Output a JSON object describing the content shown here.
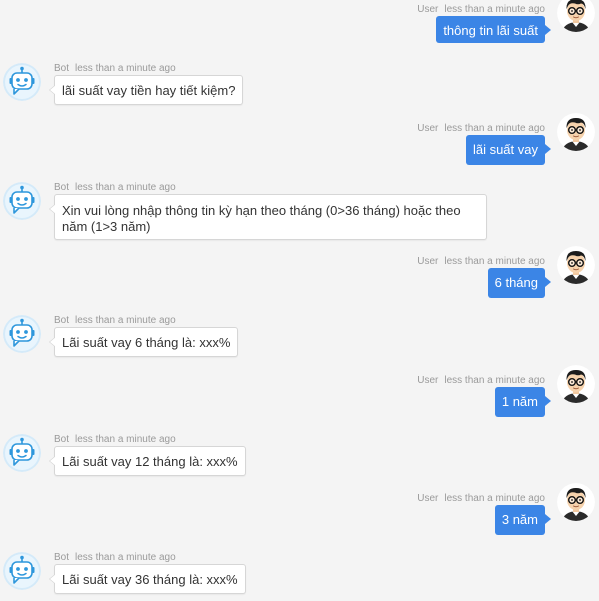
{
  "messages": [
    {
      "sender": "User",
      "time": "less than a minute ago",
      "text": "thông tin lãi suất"
    },
    {
      "sender": "Bot",
      "time": "less than a minute ago",
      "text": "lãi suất vay tiền hay tiết kiệm?"
    },
    {
      "sender": "User",
      "time": "less than a minute ago",
      "text": "lãi suất vay"
    },
    {
      "sender": "Bot",
      "time": "less than a minute ago",
      "text": "Xin vui lòng nhập thông tin kỳ hạn theo tháng (0>36 tháng) hoặc theo năm (1>3 năm)"
    },
    {
      "sender": "User",
      "time": "less than a minute ago",
      "text": "6 tháng"
    },
    {
      "sender": "Bot",
      "time": "less than a minute ago",
      "text": "Lãi suất vay 6 tháng là: xxx%"
    },
    {
      "sender": "User",
      "time": "less than a minute ago",
      "text": "1 năm"
    },
    {
      "sender": "Bot",
      "time": "less than a minute ago",
      "text": "Lãi suất vay 12 tháng là: xxx%"
    },
    {
      "sender": "User",
      "time": "less than a minute ago",
      "text": "3 năm"
    },
    {
      "sender": "Bot",
      "time": "less than a minute ago",
      "text": "Lãi suất vay 36 tháng là: xxx%"
    }
  ],
  "icons": {
    "bot_avatar": "robot-icon",
    "user_avatar": "man-with-glasses-icon"
  },
  "colors": {
    "background": "#f4f4f4",
    "user_bubble": "#3b85e6",
    "bot_bubble": "#ffffff",
    "bot_avatar_bg": "#cfe7f8",
    "bot_icon": "#2e97dc"
  }
}
